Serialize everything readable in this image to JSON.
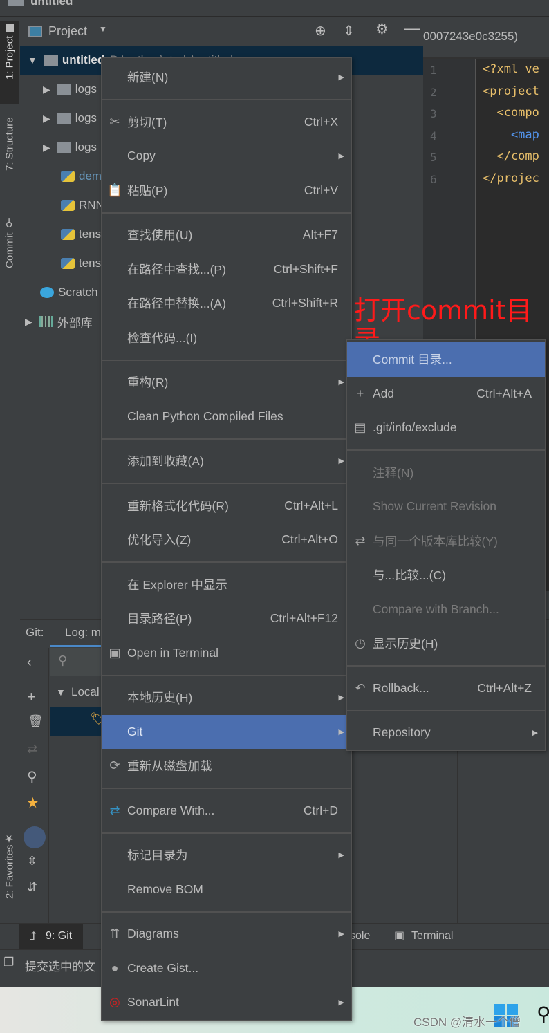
{
  "titlebar": {
    "project": "untitled"
  },
  "left_stripe": {
    "project": "1: Project",
    "structure": "7: Structure",
    "commit": "Commit",
    "favorites": "2: Favorites"
  },
  "project_panel": {
    "title": "Project",
    "tree": [
      {
        "label": "untitled",
        "extra": "D:\\python\\study\\untitled",
        "type": "folder",
        "selected": true
      },
      {
        "label": "logs",
        "type": "folder"
      },
      {
        "label": "logs",
        "type": "folder"
      },
      {
        "label": "logs",
        "type": "folder"
      },
      {
        "label": "dem",
        "type": "python",
        "modified": true
      },
      {
        "label": "RNN",
        "type": "python"
      },
      {
        "label": "tens",
        "type": "python"
      },
      {
        "label": "tens",
        "type": "python"
      },
      {
        "label": "Scratch",
        "type": "scratch"
      },
      {
        "label": "外部库",
        "type": "library"
      }
    ]
  },
  "editor": {
    "tab": "0007243e0c3255)",
    "lines": [
      "1",
      "2",
      "3",
      "4",
      "5",
      "6"
    ],
    "code": [
      "<?xml ve",
      "<project",
      "  <compo",
      "    <map",
      "  </comp",
      "</projec"
    ]
  },
  "git_panel": {
    "git_label": "Git:",
    "log_tab": "Log: m",
    "local": "Local"
  },
  "bottom_bar": {
    "git": "9: Git",
    "console": "sole",
    "terminal": "Terminal"
  },
  "status": {
    "text": "提交选中的文"
  },
  "annotation": "打开commit目录",
  "watermark": "CSDN @清水一个僧",
  "context_menu": [
    {
      "label": "新建(N)",
      "submenu": true
    },
    {
      "sep": true
    },
    {
      "label": "剪切(T)",
      "icon": "✂",
      "icon_name": "scissors-icon",
      "shortcut": "Ctrl+X"
    },
    {
      "label": "Copy",
      "submenu": true
    },
    {
      "label": "粘贴(P)",
      "icon": "📋",
      "icon_name": "clipboard-icon",
      "shortcut": "Ctrl+V"
    },
    {
      "sep": true
    },
    {
      "label": "查找使用(U)",
      "shortcut": "Alt+F7"
    },
    {
      "label": "在路径中查找...(P)",
      "shortcut": "Ctrl+Shift+F"
    },
    {
      "label": "在路径中替换...(A)",
      "shortcut": "Ctrl+Shift+R"
    },
    {
      "label": "检查代码...(I)"
    },
    {
      "sep": true
    },
    {
      "label": "重构(R)",
      "submenu": true
    },
    {
      "label": "Clean Python Compiled Files"
    },
    {
      "sep": true
    },
    {
      "label": "添加到收藏(A)",
      "submenu": true
    },
    {
      "sep": true
    },
    {
      "label": "重新格式化代码(R)",
      "shortcut": "Ctrl+Alt+L"
    },
    {
      "label": "优化导入(Z)",
      "shortcut": "Ctrl+Alt+O"
    },
    {
      "sep": true
    },
    {
      "label": "在 Explorer 中显示"
    },
    {
      "label": "目录路径(P)",
      "shortcut": "Ctrl+Alt+F12"
    },
    {
      "label": "Open in Terminal",
      "icon": "▣",
      "icon_name": "terminal-icon"
    },
    {
      "sep": true
    },
    {
      "label": "本地历史(H)",
      "submenu": true
    },
    {
      "label": "Git",
      "submenu": true,
      "highlighted": true
    },
    {
      "label": "重新从磁盘加载",
      "icon": "⟳",
      "icon_name": "reload-icon"
    },
    {
      "sep": true
    },
    {
      "label": "Compare With...",
      "icon": "⇄",
      "icon_name": "compare-icon",
      "shortcut": "Ctrl+D"
    },
    {
      "sep": true
    },
    {
      "label": "标记目录为",
      "submenu": true
    },
    {
      "label": "Remove BOM"
    },
    {
      "sep": true
    },
    {
      "label": "Diagrams",
      "icon": "⇈",
      "icon_name": "diagrams-icon",
      "submenu": true
    },
    {
      "label": "Create Gist...",
      "icon": "●",
      "icon_name": "github-icon"
    },
    {
      "label": "SonarLint",
      "icon": "◎",
      "icon_name": "sonarlint-icon",
      "submenu": true
    }
  ],
  "git_submenu": [
    {
      "label": "Commit 目录...",
      "highlighted": true
    },
    {
      "label": "Add",
      "icon": "+",
      "icon_name": "plus-icon",
      "shortcut": "Ctrl+Alt+A"
    },
    {
      "label": ".git/info/exclude",
      "icon": "▤",
      "icon_name": "ignore-file-icon"
    },
    {
      "sep": true
    },
    {
      "label": "注释(N)",
      "disabled": true
    },
    {
      "label": "Show Current Revision",
      "disabled": true
    },
    {
      "label": "与同一个版本库比较(Y)",
      "icon": "⇄",
      "icon_name": "compare-icon",
      "disabled": true
    },
    {
      "label": "与...比较...(C)"
    },
    {
      "label": "Compare with Branch...",
      "disabled": true
    },
    {
      "label": "显示历史(H)",
      "icon": "◷",
      "icon_name": "clock-icon"
    },
    {
      "sep": true
    },
    {
      "label": "Rollback...",
      "icon": "↶",
      "icon_name": "rollback-icon",
      "shortcut": "Ctrl+Alt+Z"
    },
    {
      "sep": true
    },
    {
      "label": "Repository",
      "submenu": true
    }
  ],
  "colors": {
    "highlight": "#4b6eaf",
    "annotation": "#ff1a1a",
    "selection": "#0d293e"
  }
}
